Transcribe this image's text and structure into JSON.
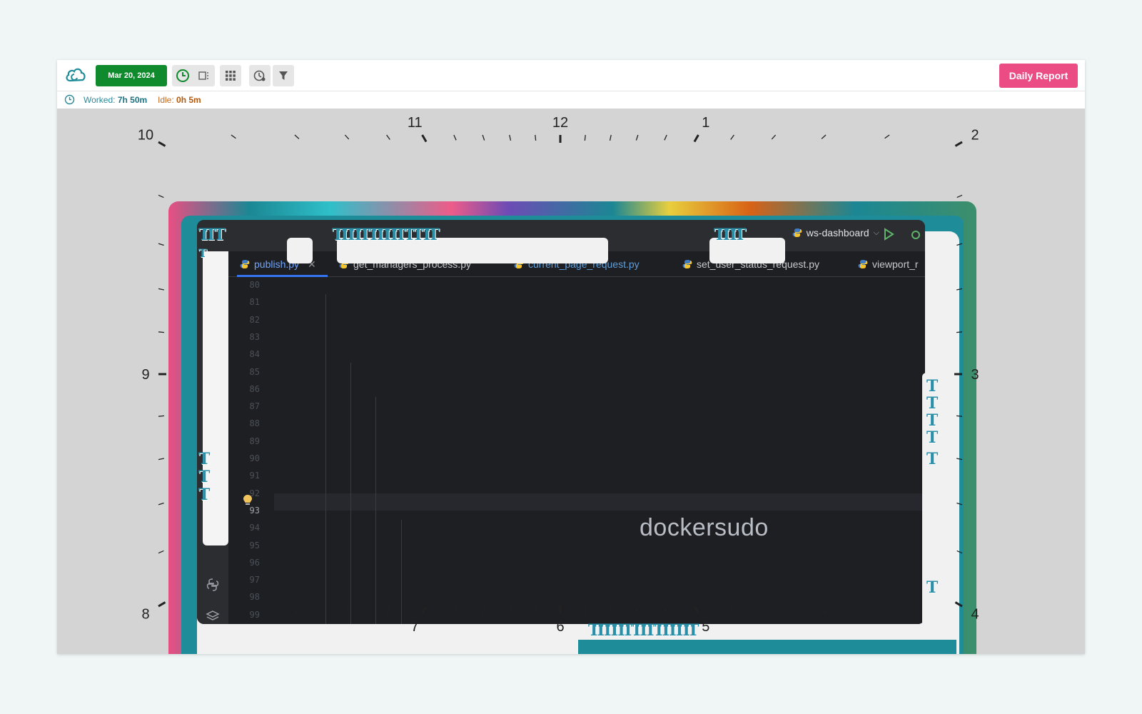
{
  "toolbar": {
    "date_label": "Mar 20, 2024",
    "report_label": "Daily Report"
  },
  "status": {
    "worked_label": "Worked:",
    "worked_value": "7h 50m",
    "idle_label": "Idle:",
    "idle_value": "0h 5m"
  },
  "dial": {
    "hour_labels": [
      "10",
      "11",
      "12",
      "1",
      "2",
      "3",
      "4",
      "5",
      "6",
      "7",
      "8",
      "9"
    ]
  },
  "ide": {
    "project": "ws-dashboard",
    "tabs": [
      {
        "label": "publish.py",
        "state": "active"
      },
      {
        "label": "get_managers_process.py",
        "state": "normal"
      },
      {
        "label": "current_page_request.py",
        "state": "modified"
      },
      {
        "label": "set_user_status_request.py",
        "state": "normal"
      },
      {
        "label": "viewport_r",
        "state": "normal"
      }
    ],
    "line_numbers": [
      "80",
      "81",
      "82",
      "83",
      "84",
      "85",
      "86",
      "87",
      "88",
      "89",
      "90",
      "91",
      "92",
      "93",
      "94",
      "95",
      "96",
      "97",
      "98",
      "99"
    ],
    "current_line": "93"
  },
  "watermark": "dockersudo",
  "colors": {
    "date_button": "#0f8a2c",
    "report_button": "#ec4c84",
    "ide_background": "#1e1f22",
    "accent_teal": "#1f8c9a"
  }
}
